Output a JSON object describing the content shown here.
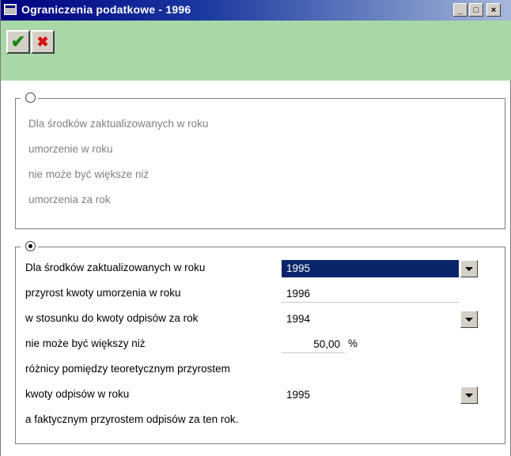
{
  "window": {
    "title": "Ograniczenia podatkowe - 1996"
  },
  "titlebar_buttons": {
    "minimize": "_",
    "maximize": "□",
    "close": "×"
  },
  "toolbar": {
    "accept_glyph": "✔",
    "cancel_glyph": "✖",
    "accept_color": "#1a8a1a",
    "cancel_color": "#d81010"
  },
  "option1": {
    "selected": false,
    "lines": [
      "Dla środków zaktualizowanych w roku",
      "umorzenie w roku",
      "nie może być większe niż",
      "umorzenia za rok"
    ]
  },
  "option2": {
    "selected": true,
    "row1_label": "Dla środków zaktualizowanych w roku",
    "row1_value": "1995",
    "row2_label": "przyrost kwoty umorzenia w roku",
    "row2_value": "1996",
    "row3_label": "w stosunku do kwoty odpisów za rok",
    "row3_value": "1994",
    "row4_label": "nie może być większy niż",
    "row4_value": "50,00",
    "row4_unit": "%",
    "row5_label": "różnicy pomiędzy teoretycznym przyrostem",
    "row6_label": "kwoty odpisów w roku",
    "row6_value": "1995",
    "row7_label": "a faktycznym przyrostem odpisów za ten rok."
  }
}
